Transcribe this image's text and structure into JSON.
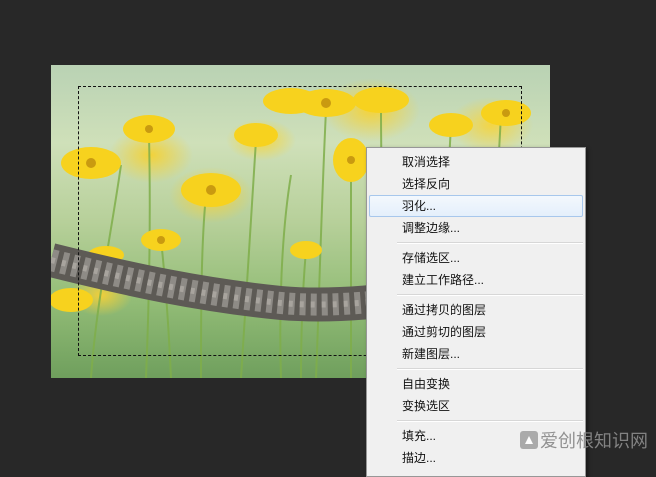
{
  "menu": {
    "groups": [
      [
        "取消选择",
        "选择反向",
        "羽化...",
        "调整边缘..."
      ],
      [
        "存储选区...",
        "建立工作路径..."
      ],
      [
        "通过拷贝的图层",
        "通过剪切的图层",
        "新建图层..."
      ],
      [
        "自由变换",
        "变换选区"
      ],
      [
        "填充...",
        "描边..."
      ]
    ],
    "hovered_item": "羽化..."
  },
  "watermark": {
    "text": "爱创根知识网"
  },
  "colors": {
    "workspace": "#282828",
    "menu_bg": "#f0f0f0",
    "hover_border": "#a7c7ec"
  }
}
